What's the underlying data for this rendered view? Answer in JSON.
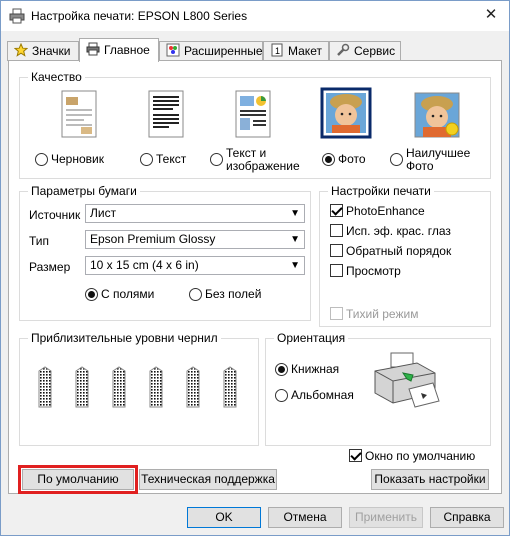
{
  "window": {
    "title": "Настройка печати: EPSON L800 Series",
    "close": "✕"
  },
  "tabs": [
    {
      "label": "Значки"
    },
    {
      "label": "Главное"
    },
    {
      "label": "Расширенные"
    },
    {
      "label": "Макет"
    },
    {
      "label": "Сервис"
    }
  ],
  "quality": {
    "label": "Качество",
    "options": [
      {
        "label": "Черновик",
        "selected": false
      },
      {
        "label": "Текст",
        "selected": false
      },
      {
        "label_line1": "Текст и",
        "label_line2": "изображение",
        "selected": false
      },
      {
        "label": "Фото",
        "selected": true
      },
      {
        "label_line1": "Наилучшее",
        "label_line2": "Фото",
        "selected": false
      }
    ]
  },
  "paper": {
    "label": "Параметры бумаги",
    "source_label": "Источник",
    "source_value": "Лист",
    "type_label": "Тип",
    "type_value": "Epson Premium Glossy",
    "size_label": "Размер",
    "size_value": "10 x 15 cm (4 x 6 in)",
    "margins_label": "С полями",
    "borderless_label": "Без полей",
    "margins_selected": true
  },
  "print_settings": {
    "label": "Настройки печати",
    "photoenhance": {
      "label": "PhotoEnhance",
      "checked": true
    },
    "redeye": {
      "label": "Исп. эф. крас. глаз",
      "checked": false
    },
    "reverse": {
      "label": "Обратный порядок",
      "checked": false
    },
    "preview": {
      "label": "Просмотр",
      "checked": false
    },
    "quiet": {
      "label": "Тихий режим",
      "checked": false,
      "disabled": true
    }
  },
  "ink": {
    "label": "Приблизительные уровни чернил",
    "tanks": 6
  },
  "orientation": {
    "label": "Ориентация",
    "portrait": "Книжная",
    "landscape": "Альбомная",
    "portrait_selected": true
  },
  "show_default": {
    "label": "Окно по умолчанию",
    "checked": true
  },
  "buttons": {
    "defaults": "По умолчанию",
    "support": "Техническая поддержка",
    "show_settings": "Показать настройки",
    "ok": "OK",
    "cancel": "Отмена",
    "apply": "Применить",
    "help": "Справка"
  },
  "colors": {
    "accent": "#0078d7",
    "highlight": "#e02020"
  }
}
